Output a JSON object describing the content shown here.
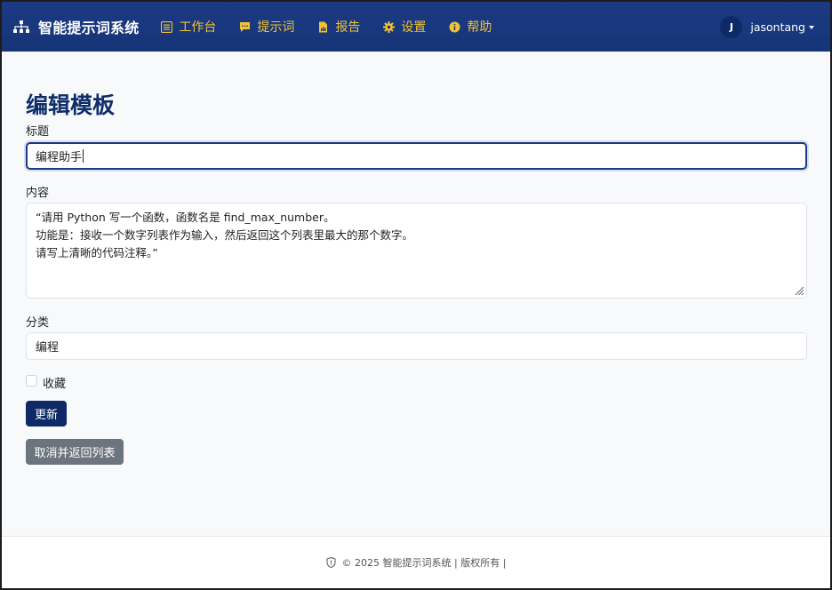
{
  "navbar": {
    "brand": "智能提示词系统",
    "items": [
      {
        "label": "工作台",
        "icon": "workbench-icon"
      },
      {
        "label": "提示词",
        "icon": "chat-icon"
      },
      {
        "label": "报告",
        "icon": "report-icon"
      },
      {
        "label": "设置",
        "icon": "gear-icon"
      },
      {
        "label": "帮助",
        "icon": "info-icon"
      }
    ],
    "user": {
      "initial": "J",
      "name": "jasontang"
    },
    "accent_color": "#f1c232",
    "bg_color": "#163577"
  },
  "form": {
    "page_title": "编辑模板",
    "title_label": "标题",
    "title_value": "编程助手",
    "content_label": "内容",
    "content_lines": [
      "“请用 Python 写一个函数，函数名是 find_max_number。",
      "功能是：接收一个数字列表作为输入，然后返回这个列表里最大的那个数字。",
      "请写上清晰的代码注释。”"
    ],
    "category_label": "分类",
    "category_value": "编程",
    "favorite_label": "收藏",
    "favorite_checked": false,
    "update_button": "更新",
    "cancel_button": "取消并返回列表"
  },
  "footer": {
    "text": "© 2025 智能提示词系统 | 版权所有 |"
  }
}
